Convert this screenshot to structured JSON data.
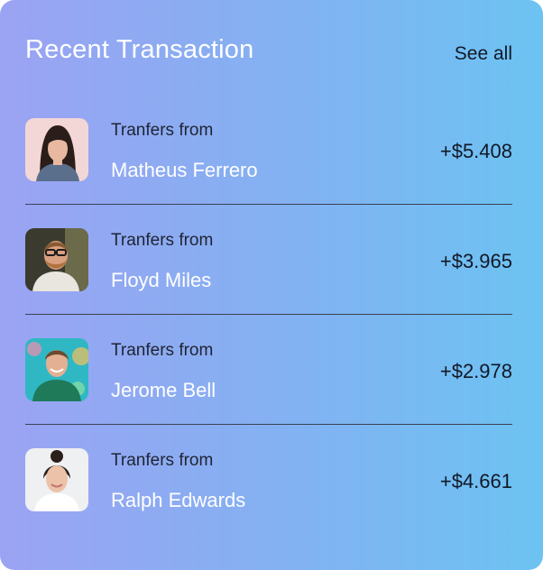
{
  "card": {
    "title": "Recent Transaction",
    "see_all_label": "See all"
  },
  "transactions": [
    {
      "caption": "Tranfers from",
      "name": "Matheus Ferrero",
      "amount": "+$5.408",
      "avatar": "woman-dark-hair-avatar"
    },
    {
      "caption": "Tranfers from",
      "name": "Floyd Miles",
      "amount": "+$3.965",
      "avatar": "man-glasses-beard-avatar"
    },
    {
      "caption": "Tranfers from",
      "name": "Jerome Bell",
      "amount": "+$2.978",
      "avatar": "man-smiling-green-shirt-avatar"
    },
    {
      "caption": "Tranfers from",
      "name": "Ralph Edwards",
      "amount": "+$4.661",
      "avatar": "woman-hair-bun-avatar"
    }
  ],
  "colors": {
    "gradient_start": "#9ba3f3",
    "gradient_end": "#6cc3f2",
    "title": "#ffffff",
    "name": "#ffffff",
    "text_dark": "#111827",
    "divider": "#3b4152"
  }
}
